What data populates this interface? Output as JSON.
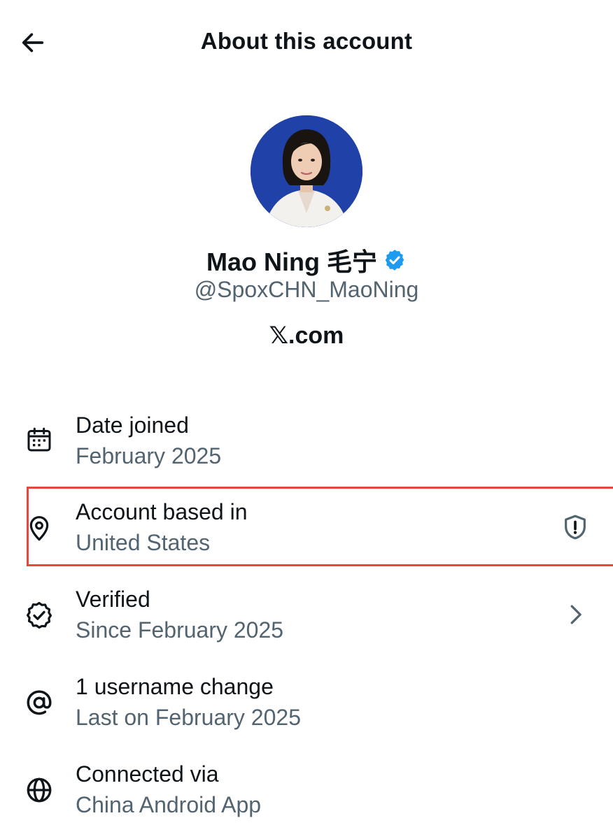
{
  "header": {
    "title": "About this account",
    "back_icon": "arrow-left-icon"
  },
  "profile": {
    "display_name": "Mao Ning 毛宁",
    "handle": "@SpoxCHN_MaoNing",
    "origin_mark": "𝕏",
    "origin_suffix": ".com",
    "badge_color": "#1d9bf0"
  },
  "details": [
    {
      "icon": "calendar-icon",
      "title": "Date joined",
      "value": "February 2025"
    },
    {
      "icon": "location-pin-icon",
      "title": "Account based in",
      "value": "United States",
      "trailing_icon": "shield-alert-icon",
      "highlighted": true
    },
    {
      "icon": "verified-seal-icon",
      "title": "Verified",
      "value": "Since February 2025",
      "trailing_icon": "chevron-right-icon"
    },
    {
      "icon": "at-sign-icon",
      "title": "1 username change",
      "value": "Last on February 2025"
    },
    {
      "icon": "globe-icon",
      "title": "Connected via",
      "value": "China Android App"
    }
  ],
  "colors": {
    "text_primary": "#0f1419",
    "text_secondary": "#536471",
    "highlight_border": "#e8453c",
    "verified_blue": "#1d9bf0"
  }
}
